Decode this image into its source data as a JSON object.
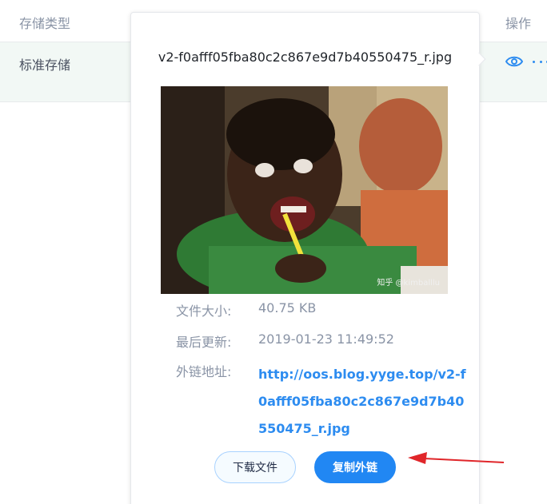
{
  "table": {
    "col_storage": "存储类型",
    "col_actions": "操作",
    "row_storage": "标准存储"
  },
  "popover": {
    "file_name": "v2-f0afff05fba80c2c867e9d7b40550475_r.jpg",
    "watermark": "知乎 @kimballlu",
    "size_label": "文件大小:",
    "size_value": "40.75 KB",
    "updated_label": "最后更新:",
    "updated_value": "2019-01-23 11:49:52",
    "link_label": "外链地址:",
    "link_value": "http://oos.blog.yyge.top/v2-f0afff05fba80c2c867e9d7b40550475_r.jpg",
    "download_button": "下载文件",
    "copy_button": "复制外链"
  },
  "colors": {
    "accent": "#2d8cf0",
    "primary_button": "#2187f3",
    "annotation_arrow": "#e0262a",
    "row_highlight": "#f2f8f5"
  },
  "icons": {
    "view": "eye-icon",
    "more": "more-icon"
  }
}
